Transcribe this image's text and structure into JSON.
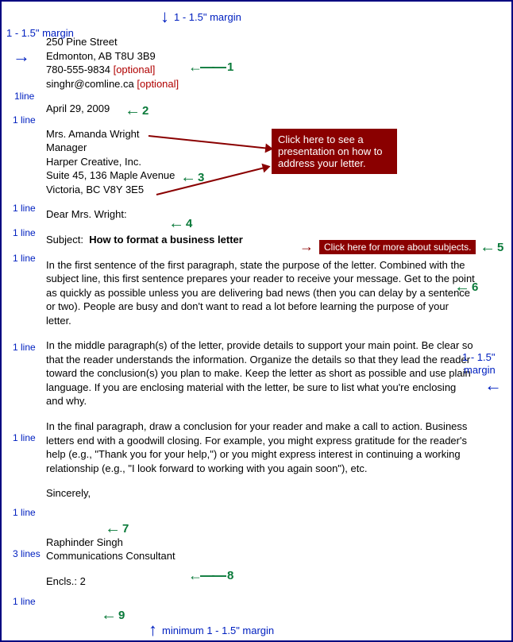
{
  "margins": {
    "top": "1 - 1.5\" margin",
    "left": "1 - 1.5\" margin",
    "right_top": "1 - 1.5\"",
    "right_bottom_word": "margin",
    "bottom": "minimum 1 - 1.5\" margin"
  },
  "spacing": {
    "one_line": "1 line",
    "one_line_alt": "1line",
    "three_lines": "3 lines"
  },
  "sender": {
    "street": "250 Pine Street",
    "city": "Edmonton, AB T8U 3B9",
    "phone": "780-555-9834",
    "phone_note": "[optional]",
    "email": "singhr@comline.ca",
    "email_note": "[optional]"
  },
  "date": "April 29, 2009",
  "recipient": {
    "name": "Mrs. Amanda Wright",
    "title": "Manager",
    "company": "Harper Creative, Inc.",
    "street": "Suite 45, 136 Maple Avenue",
    "city": "Victoria, BC V8Y 3E5"
  },
  "salutation": "Dear Mrs. Wright:",
  "subject": {
    "label": "Subject:",
    "text": "How to format a business letter"
  },
  "paragraphs": {
    "p1": "In the first sentence of the first paragraph, state the purpose of the letter. Combined with the subject line, this first sentence prepares your reader to receive your message. Get to the point as quickly as possible unless you are delivering bad news (then you can delay by a sentence or two). People are busy and don't want to read a lot before learning the purpose of your letter.",
    "p2": "In the middle paragraph(s) of the letter, provide details to support your main point. Be clear so that the reader understands the information. Organize the details so that they lead the reader toward the conclusion(s) you plan to make. Keep the letter as short as possible and use plain language. If you are enclosing material with the letter, be sure to list what you're enclosing and why.",
    "p3": "In the final paragraph, draw a conclusion for your reader and make a call to action. Business letters end with a goodwill closing. For example, you might express gratitude for the reader's help (e.g., \"Thank you for your help,\") or you might express interest in continuing a working relationship (e.g.,  \"I look forward to working with you again soon\"), etc."
  },
  "closing": "Sincerely,",
  "signature": {
    "name": "Raphinder Singh",
    "title": "Communications Consultant"
  },
  "enclosures": "Encls.: 2",
  "numbers": {
    "n1": "1",
    "n2": "2",
    "n3": "3",
    "n4": "4",
    "n5": "5",
    "n6": "6",
    "n7": "7",
    "n8": "8",
    "n9": "9"
  },
  "links": {
    "address_presentation": "Click here to see a presentation on how to address your letter.",
    "subjects": "Click here for more about subjects."
  }
}
